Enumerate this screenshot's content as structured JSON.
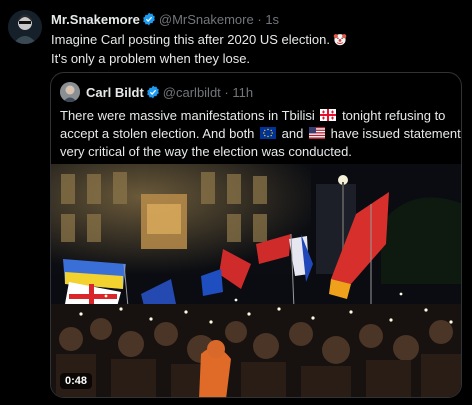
{
  "tweet": {
    "author_name": "Mr.Snakemore",
    "author_handle": "@MrSnakemore",
    "separator": "·",
    "time": "1s",
    "text_line1": "Imagine Carl posting this after 2020 US election.",
    "text_line2": "It's only a problem when they lose.",
    "emoji": "clown-face-icon"
  },
  "quote": {
    "author_name": "Carl Bildt",
    "author_handle": "@carlbildt",
    "separator": "·",
    "time": "11h",
    "line1_a": "There were massive manifestations in Tbilisi",
    "line1_b": "tonight refusing to",
    "line2": "accept a stolen election.  And both",
    "line2_and": "and",
    "line2_end": "have issued statements",
    "line3": "very critical of the way the election was conducted.",
    "flags": [
      "georgia-flag-icon",
      "eu-flag-icon",
      "us-flag-icon"
    ],
    "video_duration": "0:48"
  },
  "colors": {
    "background": "#000000",
    "text": "#e7e9ea",
    "muted": "#71767b",
    "verified": "#1d9bf0",
    "border": "#2f3336"
  }
}
